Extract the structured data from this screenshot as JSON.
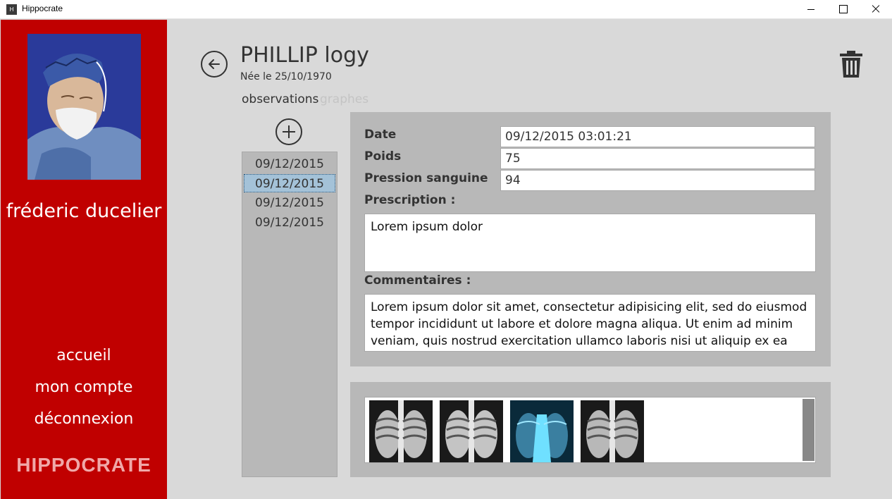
{
  "window": {
    "title": "Hippocrate",
    "icon_text": "H"
  },
  "sidebar": {
    "user_name": "fréderic ducelier",
    "nav": [
      "accueil",
      "mon compte",
      "déconnexion"
    ],
    "brand": "HIPPOCRATE",
    "accent_color": "#c00000"
  },
  "patient": {
    "name": "PHILLIP logy",
    "dob": "Née le 25/10/1970"
  },
  "tabs": {
    "observations": "observations",
    "graphes": "graphes",
    "active": "observations"
  },
  "observations": {
    "dates": [
      "09/12/2015",
      "09/12/2015",
      "09/12/2015",
      "09/12/2015"
    ],
    "selected_index": 1
  },
  "form": {
    "date_label": "Date",
    "date_value": "09/12/2015 03:01:21",
    "poids_label": "Poids",
    "poids_value": "75",
    "pression_label": "Pression sanguine",
    "pression_value": "94",
    "prescription_label": "Prescription :",
    "prescription_value": "Lorem ipsum dolor",
    "commentaires_label": "Commentaires :",
    "commentaires_value": "Lorem ipsum dolor sit amet, consectetur adipisicing elit, sed do eiusmod tempor incididunt ut labore et dolore magna aliqua. Ut enim ad minim veniam, quis nostrud exercitation ullamco laboris nisi ut aliquip ex ea"
  },
  "images": {
    "items": [
      "xray-image",
      "xray-image",
      "xray-image-blue",
      "xray-image"
    ]
  },
  "icons": [
    "back-arrow-icon",
    "trash-icon",
    "add-circle-icon"
  ]
}
